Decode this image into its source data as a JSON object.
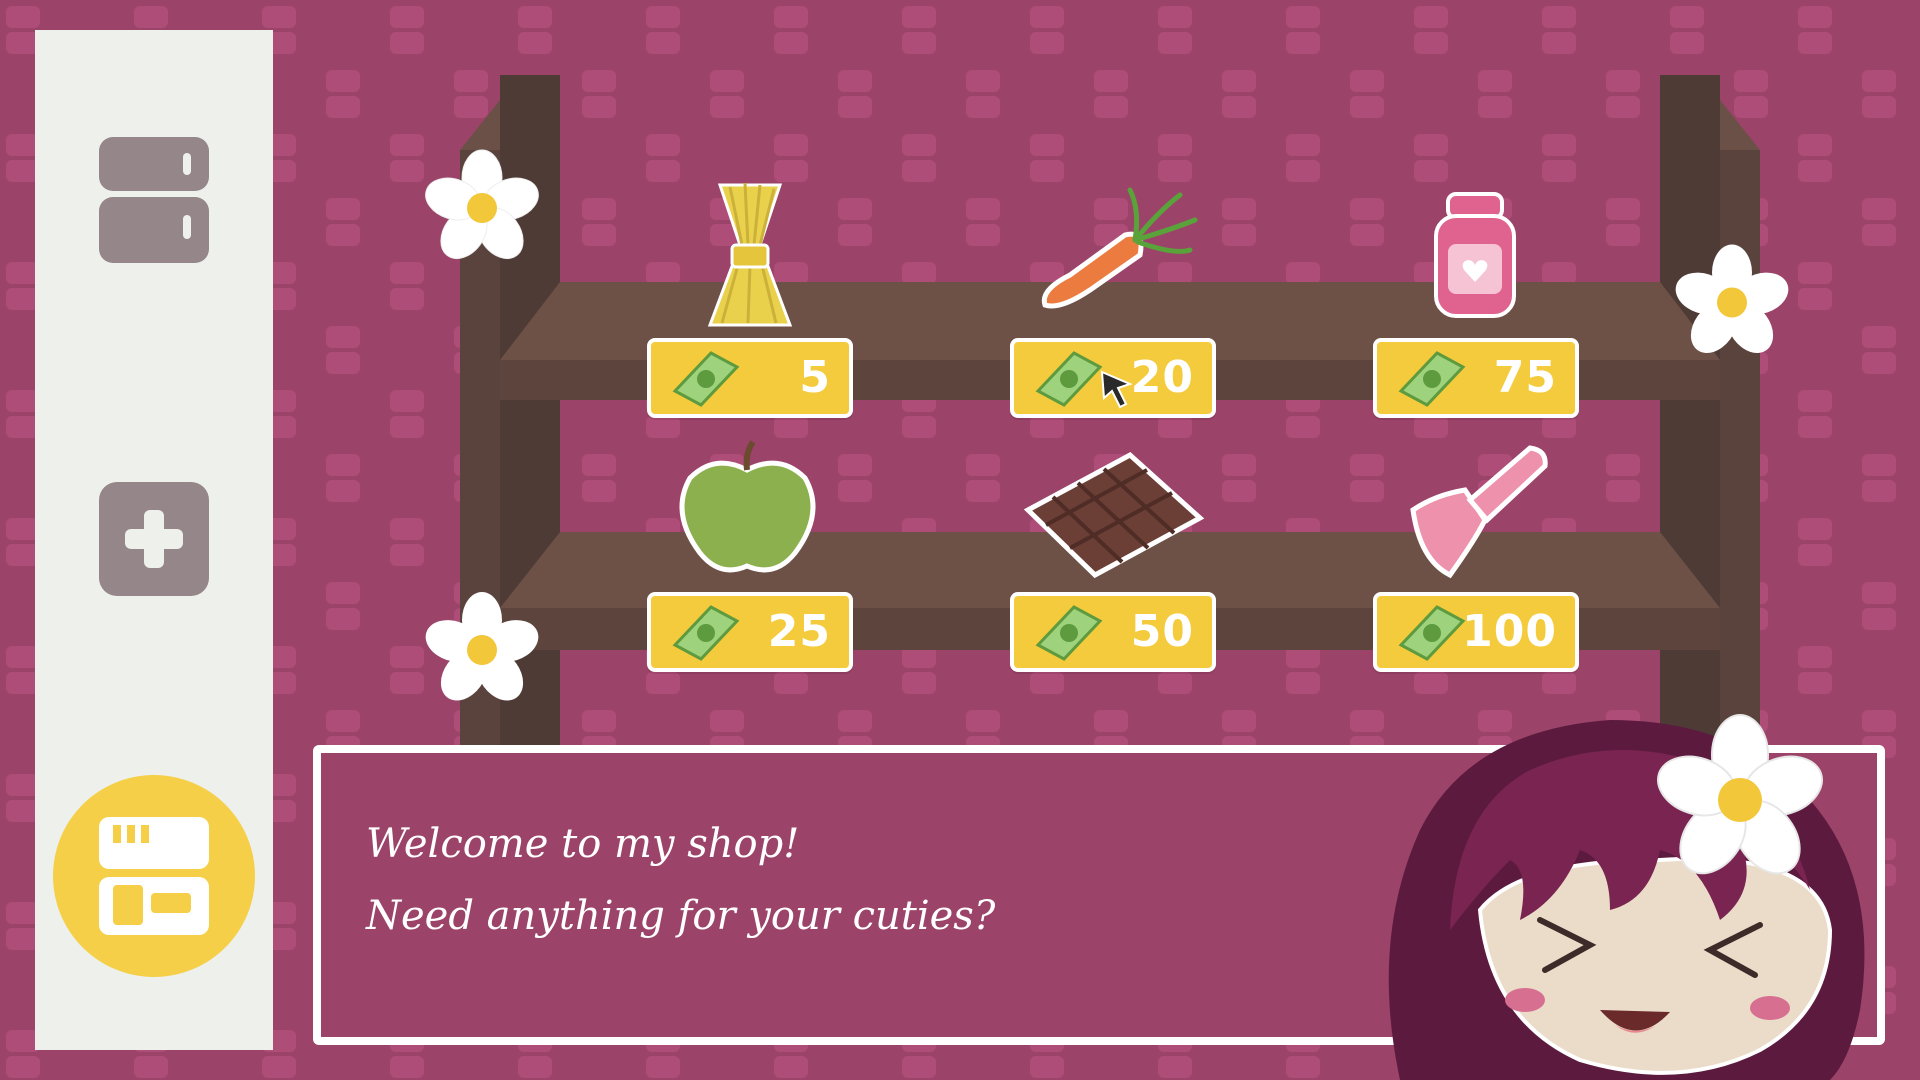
{
  "background_color": "#9b4369",
  "sidebar": {
    "buttons": [
      {
        "name": "fridge",
        "icon": "fridge-icon"
      },
      {
        "name": "health",
        "icon": "plus-icon"
      },
      {
        "name": "shop",
        "icon": "shop-logo-icon",
        "active": true
      }
    ]
  },
  "shop": {
    "currency_icon": "cash-bill-icon",
    "items": [
      {
        "name": "hay",
        "icon": "hay-bundle-icon",
        "price": "5"
      },
      {
        "name": "carrot",
        "icon": "carrot-icon",
        "price": "20"
      },
      {
        "name": "jam",
        "icon": "jam-jar-icon",
        "price": "75"
      },
      {
        "name": "apple",
        "icon": "apple-icon",
        "price": "25"
      },
      {
        "name": "chocolate",
        "icon": "chocolate-bar-icon",
        "price": "50"
      },
      {
        "name": "scoop",
        "icon": "food-scoop-icon",
        "price": "100"
      }
    ]
  },
  "dialog": {
    "line1": "Welcome to my shop!",
    "line2": "Need anything for your cuties?"
  },
  "colors": {
    "accent_yellow": "#f4cb3c",
    "shelf_wood": "#6d5147",
    "sidebar_bg": "#eef0ec",
    "icon_gray": "#95868a"
  }
}
